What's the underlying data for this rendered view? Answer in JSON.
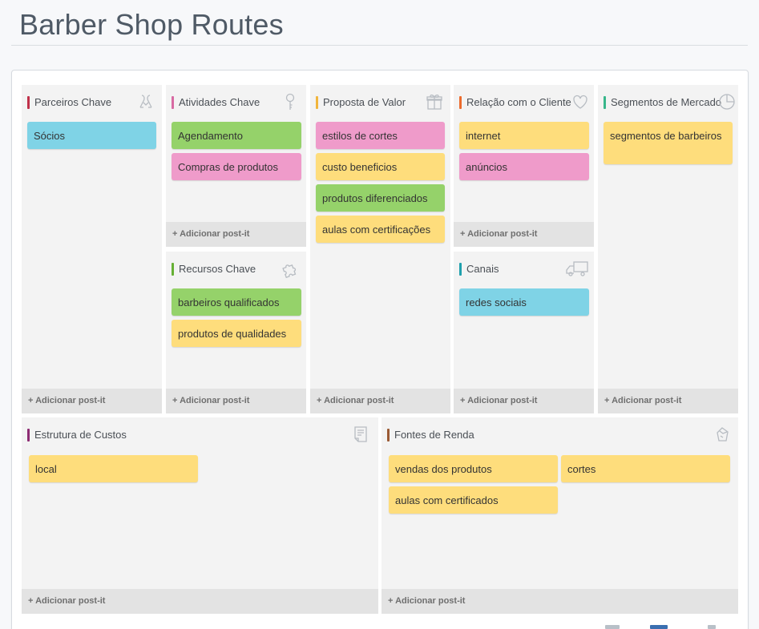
{
  "page": {
    "title": "Barber Shop Routes"
  },
  "colors": {
    "blue": "#7fd3e6",
    "green": "#95d26a",
    "pink": "#ef9bca",
    "yellow": "#fedd7c"
  },
  "add_label": "+ Adicionar post-it",
  "blocks": {
    "parceiros": {
      "title": "Parceiros Chave",
      "icon": "handshake-icon",
      "bar": "#c0314a",
      "notes": [
        "Sócios"
      ]
    },
    "atividades": {
      "title": "Atividades Chave",
      "icon": "key-icon",
      "bar": "#d86aa3",
      "notes": [
        "Agendamento",
        "Compras de produtos"
      ]
    },
    "recursos": {
      "title": "Recursos Chave",
      "icon": "puzzle-icon",
      "bar": "#66b034",
      "notes": [
        "barbeiros qualificados",
        "produtos de qualidades"
      ]
    },
    "proposta": {
      "title": "Proposta de Valor",
      "icon": "gift-icon",
      "bar": "#f1b53c",
      "notes": [
        "estilos de cortes",
        "custo beneficios",
        "produtos diferenciados",
        "aulas com certificações"
      ]
    },
    "relacao": {
      "title": "Relação com o Cliente",
      "icon": "heart-icon",
      "bar": "#ec6b2d",
      "notes": [
        "internet",
        "anúncios"
      ]
    },
    "canais": {
      "title": "Canais",
      "icon": "truck-icon",
      "bar": "#1fa0ad",
      "notes": [
        "redes sociais"
      ]
    },
    "segmentos": {
      "title": "Segmentos de Mercado",
      "icon": "pie-chart-icon",
      "bar": "#37b68a",
      "notes": [
        "segmentos de barbeiros"
      ]
    },
    "custos": {
      "title": "Estrutura de Custos",
      "icon": "receipt-icon",
      "bar": "#8d2c73",
      "notes": [
        "local"
      ]
    },
    "renda": {
      "title": "Fontes de Renda",
      "icon": "money-bag-icon",
      "bar": "#9a5a34",
      "notes": [
        "vendas dos produtos",
        "cortes",
        "aulas com certificados"
      ]
    }
  }
}
